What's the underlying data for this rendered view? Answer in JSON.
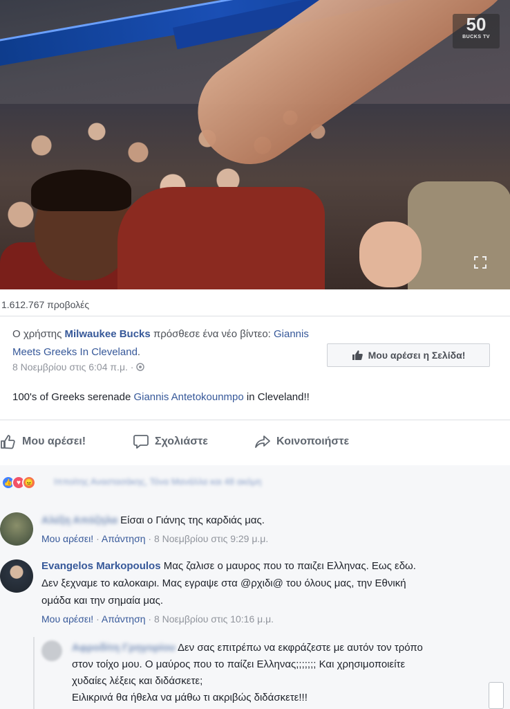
{
  "video": {
    "badge_number": "50",
    "badge_sub": "BUCKS TV",
    "fullscreen_icon": "fullscreen-icon"
  },
  "post": {
    "views": "1.612.767 προβολές",
    "prefix": "Ο χρήστης ",
    "page_name": "Milwaukee Bucks",
    "middle": " πρόσθεσε ένα νέο βίντεο: ",
    "video_title": "Giannis Meets Greeks In Cleveland",
    "end": ".",
    "date": "8 Νοεμβρίου στις 6:04 π.μ. · ",
    "like_page_label": "Μου αρέσει η Σελίδα!",
    "text_before": "100's of Greeks serenade ",
    "text_link": "Giannis Antetokounmpo",
    "text_after": " in Cleveland!!"
  },
  "actions": {
    "like": "Μου αρέσει!",
    "comment": "Σχολιάστε",
    "share": "Κοινοποιήστε"
  },
  "reactions": {
    "names_blurred": "Ιπποίτης Αναστασάκης, Τόνα Μανάλλα και 48 ακόμη",
    "colors": {
      "like": "#4080ff",
      "love": "#f25268",
      "angry": "#f7714c"
    }
  },
  "comments": [
    {
      "name_blurred": "Αλέξη Απόζηλα",
      "text": "Είσαι ο Γιάνης της καρδιάς μας.",
      "like": "Μου αρέσει!",
      "reply": "Απάντηση",
      "time": "8 Νοεμβρίου στις 9:29 μ.μ."
    },
    {
      "name": "Evangelos Markopoulos",
      "text_line1": " Μας ζαλισε ο μαυρος που το παιζει Ελληνας. Εως εδω.",
      "text_line2": "Δεν ξεχναμε το καλοκαιρι. Μας εγραψε στα @ρχιδι@ του όλους μας, την Εθνική",
      "text_line3": "ομάδα και την σημαία μας.",
      "like": "Μου αρέσει!",
      "reply": "Απάντηση",
      "time": "8 Νοεμβρίου στις 10:16 μ.μ."
    }
  ],
  "reply": {
    "name_blurred": "Αφροδίτη Γρηγορίου",
    "line1": " Δεν σας επιτρέπω να εκφράζεστε με αυτόν τον τρόπο",
    "line2": "στον τοίχο μου. Ο μαύρος που το παίζει Ελληνας;;;;;;; Και χρησιμοποιείτε",
    "line3": "χυδαίες λέξεις και διδάσκετε;",
    "line4": "Ειλικρινά θα ήθελα να μάθω τι ακριβώς διδάσκετε!!!"
  }
}
